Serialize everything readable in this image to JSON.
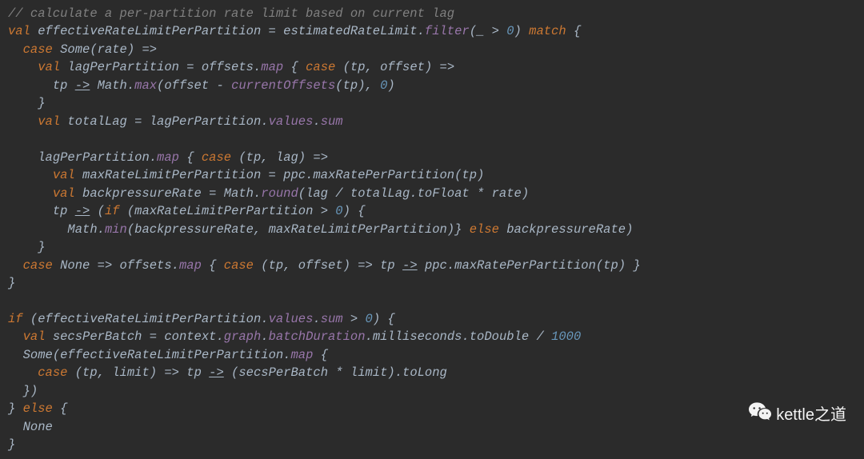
{
  "code": {
    "l1": "// calculate a per-partition rate limit based on current lag",
    "l2a": "val",
    "l2b": " effectiveRateLimitPerPartition = estimatedRateLimit.",
    "l2c": "filter",
    "l2d": "(_ > ",
    "l2e": "0",
    "l2f": ") ",
    "l2g": "match",
    "l2h": " {",
    "l3a": "case",
    "l3b": " Some(rate) =>",
    "l4a": "val",
    "l4b": " lagPerPartition = offsets.",
    "l4c": "map",
    "l4d": " { ",
    "l4e": "case",
    "l4f": " (tp, offset) =>",
    "l5a": "tp ",
    "l5b": "->",
    "l5c": " Math.",
    "l5d": "max",
    "l5e": "(offset - ",
    "l5f": "currentOffsets",
    "l5g": "(tp), ",
    "l5h": "0",
    "l5i": ")",
    "l6": "}",
    "l7a": "val",
    "l7b": " totalLag = lagPerPartition.",
    "l7c": "values",
    "l7d": ".",
    "l7e": "sum",
    "l8": "",
    "l9a": "lagPerPartition.",
    "l9b": "map",
    "l9c": " { ",
    "l9d": "case",
    "l9e": " (tp, lag) =>",
    "l10a": "val",
    "l10b": " maxRateLimitPerPartition = ppc.maxRatePerPartition(tp)",
    "l11a": "val",
    "l11b": " backpressureRate = Math.",
    "l11c": "round",
    "l11d": "(lag / totalLag.toFloat * rate)",
    "l12a": "tp ",
    "l12b": "->",
    "l12c": " (",
    "l12d": "if",
    "l12e": " (maxRateLimitPerPartition > ",
    "l12f": "0",
    "l12g": ") {",
    "l13a": "Math.",
    "l13b": "min",
    "l13c": "(backpressureRate, maxRateLimitPerPartition)} ",
    "l13d": "else",
    "l13e": " backpressureRate)",
    "l14": "}",
    "l15a": "case",
    "l15b": " None => offsets.",
    "l15c": "map",
    "l15d": " { ",
    "l15e": "case",
    "l15f": " (tp, offset) => tp ",
    "l15g": "->",
    "l15h": " ppc.maxRatePerPartition(tp) }",
    "l16": "}",
    "l17": "",
    "l18a": "if",
    "l18b": " (effectiveRateLimitPerPartition.",
    "l18c": "values",
    "l18d": ".",
    "l18e": "sum",
    "l18f": " > ",
    "l18g": "0",
    "l18h": ") {",
    "l19a": "val",
    "l19b": " secsPerBatch = context.",
    "l19c": "graph",
    "l19d": ".",
    "l19e": "batchDuration",
    "l19f": ".milliseconds.toDouble / ",
    "l19g": "1000",
    "l20a": "Some",
    "l20b": "(effectiveRateLimitPerPartition.",
    "l20c": "map",
    "l20d": " {",
    "l21a": "case",
    "l21b": " (tp, limit) => tp ",
    "l21c": "->",
    "l21d": " (secsPerBatch * limit).toLong",
    "l22": "})",
    "l23a": "} ",
    "l23b": "else",
    "l23c": " {",
    "l24": "None",
    "l25": "}"
  },
  "watermark": {
    "text": "kettle之道"
  }
}
